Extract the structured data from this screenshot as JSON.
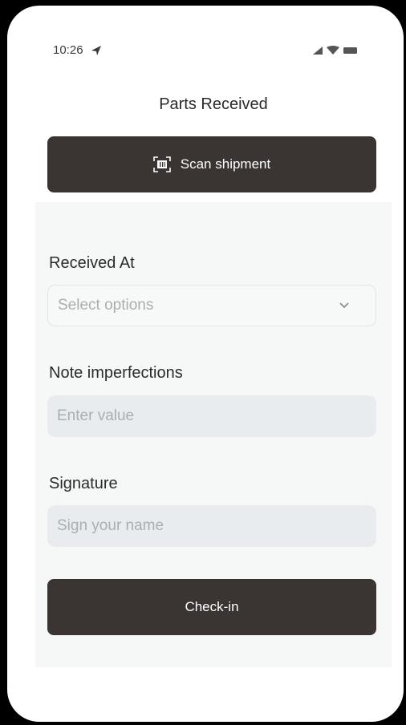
{
  "status_bar": {
    "time": "10:26"
  },
  "header": {
    "title": "Parts Received"
  },
  "scan_button": {
    "label": "Scan shipment",
    "icon": "barcode-scan-icon"
  },
  "form": {
    "received_at": {
      "label": "Received At",
      "placeholder": "Select options"
    },
    "note_imperfections": {
      "label": "Note imperfections",
      "placeholder": "Enter value"
    },
    "signature": {
      "label": "Signature",
      "placeholder": "Sign your name"
    }
  },
  "checkin_button": {
    "label": "Check-in"
  },
  "colors": {
    "button_bg": "#3a3533",
    "input_bg": "#e9ecee",
    "placeholder": "#a9aeb1"
  }
}
